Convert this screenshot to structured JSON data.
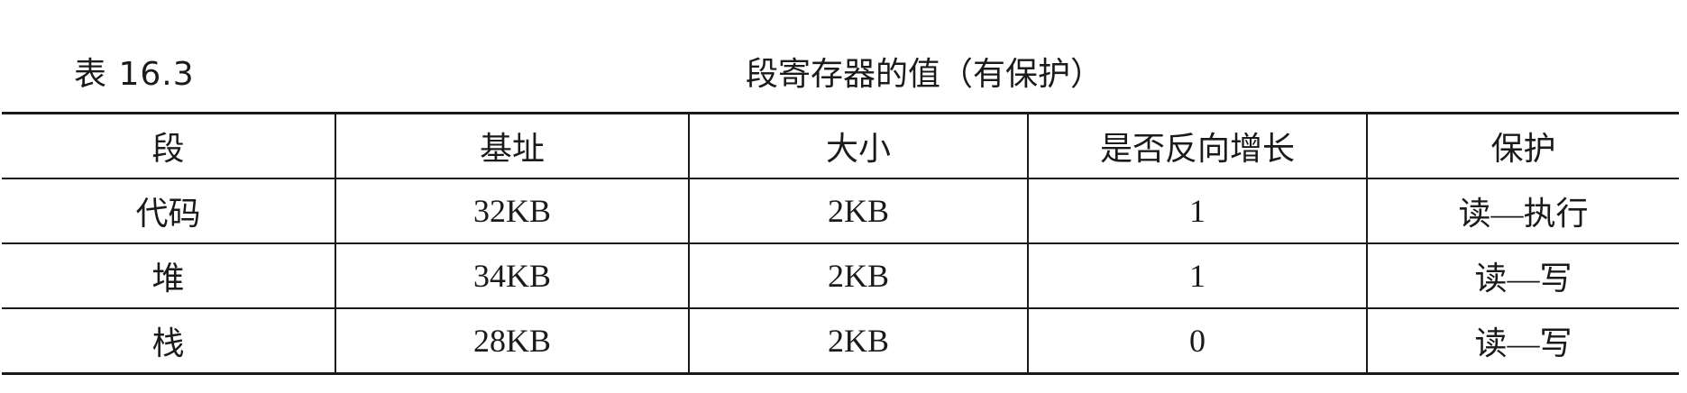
{
  "caption": {
    "label": "表 16.3",
    "title": "段寄存器的值（有保护）"
  },
  "table": {
    "headers": [
      "段",
      "基址",
      "大小",
      "是否反向增长",
      "保护"
    ],
    "rows": [
      [
        "代码",
        "32KB",
        "2KB",
        "1",
        "读—执行"
      ],
      [
        "堆",
        "34KB",
        "2KB",
        "1",
        "读—写"
      ],
      [
        "栈",
        "28KB",
        "2KB",
        "0",
        "读—写"
      ]
    ]
  }
}
